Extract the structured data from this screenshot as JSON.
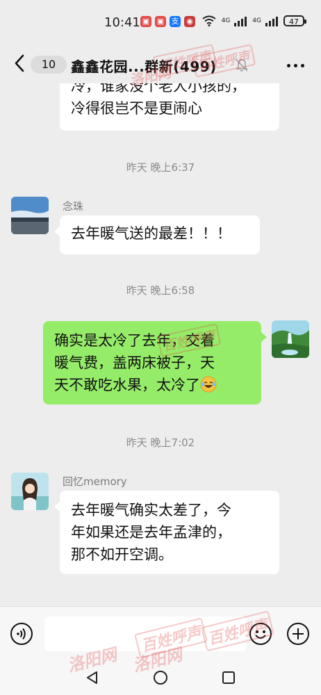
{
  "status_bar": {
    "time": "10:41",
    "app_icons": [
      "app-icon-red",
      "app-icon-red",
      "支",
      "app-icon-dark"
    ],
    "network_1": "4G",
    "network_2": "4G",
    "battery": "47"
  },
  "header": {
    "unread_count": "10",
    "title": "鑫鑫花园...群新(499)"
  },
  "messages": [
    {
      "side": "left",
      "text_line1": "冷，谁家没个老人小孩的，",
      "text_line2": "冷得很岂不是更闹心"
    },
    {
      "timestamp": "昨天 晚上6:37"
    },
    {
      "side": "left",
      "sender": "念珠",
      "text": "去年暖气送的最差！！！"
    },
    {
      "timestamp": "昨天 晚上6:58"
    },
    {
      "side": "right",
      "text_line1": "确实是太冷了去年，交着",
      "text_line2": "暖气费，盖两床被子，天",
      "text_line3": "天不敢吃水果，太冷了"
    },
    {
      "timestamp": "昨天 晚上7:02"
    },
    {
      "side": "left",
      "sender": "回忆memory",
      "text_line1": "去年暖气确实太差了，今",
      "text_line2": "年如果还是去年孟津的，",
      "text_line3": "那不如开空调。"
    }
  ],
  "input": {
    "placeholder": "",
    "value": ""
  },
  "watermark": {
    "brand1": "百姓呼声",
    "brand2": "洛阳网"
  },
  "colors": {
    "background": "#ededed",
    "self_bubble": "#95ec69",
    "other_bubble": "#ffffff",
    "watermark": "#e24242"
  }
}
